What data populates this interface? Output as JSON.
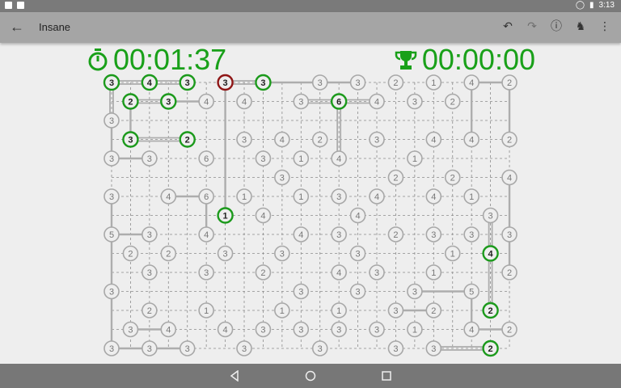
{
  "status": {
    "time": "3:13"
  },
  "toolbar": {
    "title": "Insane"
  },
  "timers": {
    "elapsed": "00:01:37",
    "best": "00:00:00"
  },
  "colors": {
    "grid": "#8c8c8c",
    "line": "#adadad",
    "node": "#a8a8a8",
    "good": "#1c9a1c",
    "error": "#8f1616",
    "text": "#777777",
    "ink": "#222222"
  },
  "board": {
    "cols": 22,
    "rows": 15,
    "nodes": [
      [
        0,
        0,
        "3",
        "good"
      ],
      [
        2,
        0,
        "4",
        "good"
      ],
      [
        4,
        0,
        "3",
        "good"
      ],
      [
        6,
        0,
        "3",
        "error"
      ],
      [
        8,
        0,
        "3",
        "good"
      ],
      [
        11,
        0,
        "3",
        ""
      ],
      [
        13,
        0,
        "3",
        ""
      ],
      [
        15,
        0,
        "2",
        ""
      ],
      [
        17,
        0,
        "1",
        ""
      ],
      [
        19,
        0,
        "4",
        ""
      ],
      [
        21,
        0,
        "2",
        ""
      ],
      [
        1,
        1,
        "2",
        "good"
      ],
      [
        3,
        1,
        "3",
        "good"
      ],
      [
        5,
        1,
        "4",
        ""
      ],
      [
        7,
        1,
        "4",
        ""
      ],
      [
        10,
        1,
        "3",
        ""
      ],
      [
        12,
        1,
        "6",
        "good"
      ],
      [
        14,
        1,
        "4",
        ""
      ],
      [
        16,
        1,
        "3",
        ""
      ],
      [
        18,
        1,
        "2",
        ""
      ],
      [
        0,
        2,
        "3",
        ""
      ],
      [
        1,
        3,
        "3",
        "good"
      ],
      [
        4,
        3,
        "2",
        "good"
      ],
      [
        7,
        3,
        "3",
        ""
      ],
      [
        9,
        3,
        "4",
        ""
      ],
      [
        11,
        3,
        "2",
        ""
      ],
      [
        14,
        3,
        "3",
        ""
      ],
      [
        17,
        3,
        "4",
        ""
      ],
      [
        19,
        3,
        "4",
        ""
      ],
      [
        21,
        3,
        "2",
        ""
      ],
      [
        0,
        4,
        "3",
        ""
      ],
      [
        2,
        4,
        "3",
        ""
      ],
      [
        5,
        4,
        "6",
        ""
      ],
      [
        8,
        4,
        "3",
        ""
      ],
      [
        10,
        4,
        "1",
        ""
      ],
      [
        12,
        4,
        "4",
        ""
      ],
      [
        16,
        4,
        "1",
        ""
      ],
      [
        9,
        5,
        "3",
        ""
      ],
      [
        15,
        5,
        "2",
        ""
      ],
      [
        18,
        5,
        "2",
        ""
      ],
      [
        21,
        5,
        "4",
        ""
      ],
      [
        0,
        6,
        "3",
        ""
      ],
      [
        3,
        6,
        "4",
        ""
      ],
      [
        5,
        6,
        "6",
        ""
      ],
      [
        7,
        6,
        "1",
        ""
      ],
      [
        10,
        6,
        "1",
        ""
      ],
      [
        12,
        6,
        "3",
        ""
      ],
      [
        14,
        6,
        "4",
        ""
      ],
      [
        17,
        6,
        "4",
        ""
      ],
      [
        19,
        6,
        "1",
        ""
      ],
      [
        6,
        7,
        "1",
        "good"
      ],
      [
        8,
        7,
        "4",
        ""
      ],
      [
        13,
        7,
        "4",
        ""
      ],
      [
        20,
        7,
        "3",
        ""
      ],
      [
        0,
        8,
        "5",
        ""
      ],
      [
        2,
        8,
        "3",
        ""
      ],
      [
        5,
        8,
        "4",
        ""
      ],
      [
        10,
        8,
        "4",
        ""
      ],
      [
        12,
        8,
        "3",
        ""
      ],
      [
        15,
        8,
        "2",
        ""
      ],
      [
        17,
        8,
        "3",
        ""
      ],
      [
        19,
        8,
        "3",
        ""
      ],
      [
        21,
        8,
        "3",
        ""
      ],
      [
        1,
        9,
        "2",
        ""
      ],
      [
        3,
        9,
        "2",
        ""
      ],
      [
        6,
        9,
        "3",
        ""
      ],
      [
        9,
        9,
        "3",
        ""
      ],
      [
        13,
        9,
        "3",
        ""
      ],
      [
        18,
        9,
        "1",
        ""
      ],
      [
        20,
        9,
        "4",
        "good"
      ],
      [
        2,
        10,
        "3",
        ""
      ],
      [
        5,
        10,
        "3",
        ""
      ],
      [
        8,
        10,
        "2",
        ""
      ],
      [
        12,
        10,
        "4",
        ""
      ],
      [
        14,
        10,
        "3",
        ""
      ],
      [
        17,
        10,
        "1",
        ""
      ],
      [
        21,
        10,
        "2",
        ""
      ],
      [
        0,
        11,
        "3",
        ""
      ],
      [
        10,
        11,
        "3",
        ""
      ],
      [
        13,
        11,
        "3",
        ""
      ],
      [
        16,
        11,
        "3",
        ""
      ],
      [
        19,
        11,
        "5",
        ""
      ],
      [
        2,
        12,
        "2",
        ""
      ],
      [
        5,
        12,
        "1",
        ""
      ],
      [
        9,
        12,
        "1",
        ""
      ],
      [
        12,
        12,
        "1",
        ""
      ],
      [
        15,
        12,
        "3",
        ""
      ],
      [
        17,
        12,
        "2",
        ""
      ],
      [
        20,
        12,
        "2",
        "good"
      ],
      [
        1,
        13,
        "3",
        ""
      ],
      [
        3,
        13,
        "4",
        ""
      ],
      [
        6,
        13,
        "4",
        ""
      ],
      [
        8,
        13,
        "3",
        ""
      ],
      [
        10,
        13,
        "3",
        ""
      ],
      [
        12,
        13,
        "3",
        ""
      ],
      [
        14,
        13,
        "3",
        ""
      ],
      [
        16,
        13,
        "1",
        ""
      ],
      [
        19,
        13,
        "4",
        ""
      ],
      [
        21,
        13,
        "2",
        ""
      ],
      [
        0,
        14,
        "3",
        ""
      ],
      [
        2,
        14,
        "3",
        ""
      ],
      [
        4,
        14,
        "3",
        ""
      ],
      [
        7,
        14,
        "3",
        ""
      ],
      [
        11,
        14,
        "3",
        ""
      ],
      [
        15,
        14,
        "3",
        ""
      ],
      [
        17,
        14,
        "3",
        ""
      ],
      [
        20,
        14,
        "2",
        "good"
      ]
    ],
    "bridges": [
      [
        0,
        0,
        2,
        0,
        2
      ],
      [
        2,
        0,
        4,
        0,
        2
      ],
      [
        6,
        0,
        8,
        0,
        2
      ],
      [
        8,
        0,
        11,
        0,
        1
      ],
      [
        11,
        0,
        13,
        0,
        1
      ],
      [
        0,
        0,
        0,
        2,
        2
      ],
      [
        6,
        0,
        6,
        7,
        1
      ],
      [
        1,
        1,
        3,
        1,
        2
      ],
      [
        3,
        1,
        5,
        1,
        1
      ],
      [
        1,
        1,
        1,
        3,
        1
      ],
      [
        10,
        1,
        12,
        1,
        2
      ],
      [
        12,
        1,
        14,
        1,
        2
      ],
      [
        12,
        1,
        12,
        4,
        2
      ],
      [
        1,
        3,
        4,
        3,
        2
      ],
      [
        0,
        2,
        0,
        4,
        1
      ],
      [
        0,
        4,
        2,
        4,
        1
      ],
      [
        3,
        6,
        5,
        6,
        1
      ],
      [
        5,
        6,
        5,
        8,
        1
      ],
      [
        0,
        6,
        0,
        8,
        1
      ],
      [
        0,
        8,
        2,
        8,
        1
      ],
      [
        0,
        8,
        0,
        11,
        1
      ],
      [
        0,
        11,
        0,
        14,
        1
      ],
      [
        0,
        14,
        2,
        14,
        1
      ],
      [
        2,
        14,
        4,
        14,
        1
      ],
      [
        1,
        13,
        3,
        13,
        1
      ],
      [
        19,
        0,
        21,
        0,
        1
      ],
      [
        19,
        0,
        19,
        3,
        1
      ],
      [
        21,
        0,
        21,
        3,
        1
      ],
      [
        21,
        5,
        21,
        8,
        1
      ],
      [
        20,
        7,
        20,
        9,
        2
      ],
      [
        20,
        9,
        20,
        12,
        2
      ],
      [
        21,
        8,
        21,
        10,
        1
      ],
      [
        19,
        11,
        19,
        13,
        1
      ],
      [
        19,
        13,
        21,
        13,
        1
      ],
      [
        15,
        12,
        17,
        12,
        1
      ],
      [
        17,
        14,
        20,
        14,
        2
      ],
      [
        16,
        11,
        19,
        11,
        1
      ]
    ]
  }
}
